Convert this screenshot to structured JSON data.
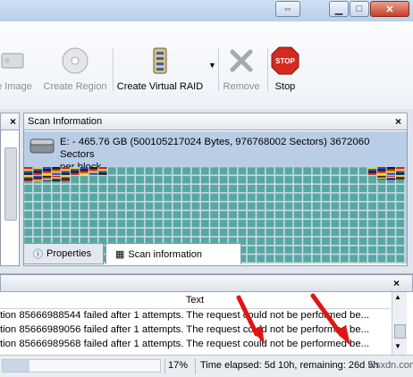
{
  "toolbar": {
    "items": [
      {
        "label": "e Image",
        "icon": "disk-image-icon",
        "enabled": false
      },
      {
        "label": "Create Region",
        "icon": "region-cd-icon",
        "enabled": false
      },
      {
        "label": "Create Virtual RAID",
        "icon": "raid-stack-icon",
        "enabled": true
      },
      {
        "label": "Remove",
        "icon": "remove-x-icon",
        "enabled": false
      },
      {
        "label": "Stop",
        "icon": "stop-sign-icon",
        "enabled": true
      }
    ],
    "stop_sign_text": "STOP"
  },
  "scan_panel": {
    "title": "Scan Information",
    "close_glyph": "×",
    "disk_line1": "E: - 465.76 GB (500105217024 Bytes, 976768002 Sectors) 3672060 Sectors",
    "disk_line2": "per block"
  },
  "tabs": [
    {
      "label": "Properties",
      "active": false
    },
    {
      "label": "Scan information",
      "active": true
    }
  ],
  "log": {
    "column_header": "Text",
    "close_glyph": "×",
    "rows": [
      "tion 85666988544 failed after 1 attempts. The request could not be performed be...",
      "tion 85666989056 failed after 1 attempts. The request could not be performed be...",
      "tion 85666989568 failed after 1 attempts. The request could not be performed be..."
    ]
  },
  "status": {
    "percent": "17%",
    "elapsed_text": "Time elapsed: 5d 10h, remaining: 26d 5h",
    "progress": 0.17
  },
  "watermark": "wsxdn.com",
  "colors": {
    "scan_cell": "#58a7a0",
    "scan_cell_border": "#d7e8ec",
    "disk_bg": "#b9cde6",
    "arrow": "#e01515"
  }
}
